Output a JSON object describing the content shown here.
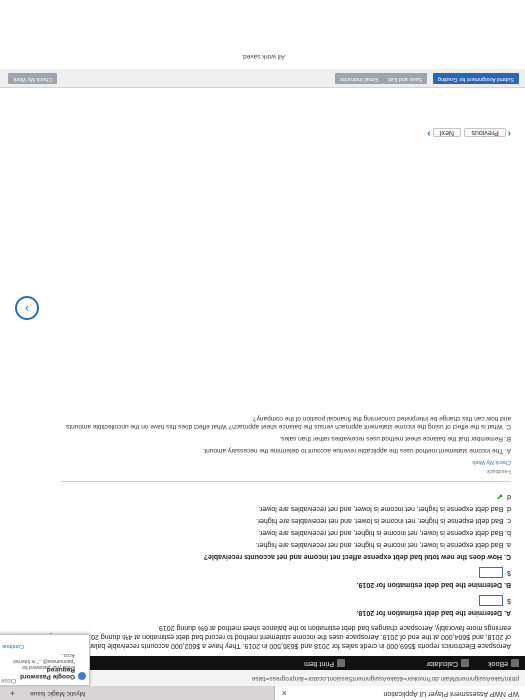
{
  "browser": {
    "tab1_title": "WP NWP Assessment Player UI Application",
    "tab2_title": "Mystic Magic Issue",
    "mail_tab": "Mystic Magic Issue",
    "url": "ptrim/takeAssignment/Main.do?invoker=&takeAssignmentSessionLocator=&inprogress=false"
  },
  "notification": {
    "title": "Google Password Required",
    "body": "Enter your password for \"pannumara@...\" in Internet Acco...",
    "close_label": "Close",
    "continue_label": "Continue"
  },
  "app_bar": {
    "ebook": "eBook",
    "calculator": "Calculator",
    "print": "Print Item"
  },
  "question": {
    "intro": "Aerospace Electronics reports $569,000 in credit sales for 2018 and $636,500 in 2019. They have a $602,000 accounts receivable balance at the end of 2018, and $604,000 at the end of 2019. Aerospace uses the income statement method to record bad debt estimation at 4% during 2018. To manage earnings more favorably, Aerospace changes bad debt estimation to the balance sheet method at 6% during 2019.",
    "part_a": "A. Determine the bad debt estimation for 2018.",
    "part_b": "B. Determine the bad debt estimation for 2019.",
    "part_c": "C. How does the new total bad debt expense affect net income and net accounts receivable?",
    "dollar": "$",
    "options": [
      "a.  Bad debt expense is lower, net income is higher, and net receivables are higher.",
      "b.  Bad debt expense is lower, net income is higher, and net receivables are lower.",
      "c.  Bad debt expense is higher, net income is lower, and net receivables are higher.",
      "d.  Bad debt expense is higher, net income is lower, and net receivables are lower."
    ],
    "selected": "d",
    "check_mark": "✔"
  },
  "feedback": {
    "title": "Feedback",
    "link": "Check My Work",
    "lines": [
      "A. The income statement method uses the applicable revenue account to determine the necessary amount.",
      "B. Remember that the balance sheet method uses receivables rather than sales.",
      "C. What is the effect of using the income statement approach versus the balance sheet approach? What effect does this have on the uncollectible amounts and how can this change be interpreted concerning the financial position of the company?"
    ]
  },
  "navigation": {
    "previous": "Previous",
    "next": "Next"
  },
  "footer": {
    "check_my_work": "Check My Work",
    "email_instructor": "Email Instructor",
    "save_and_exit": "Save and Exit",
    "submit": "Submit Assignment for Grading",
    "status": "All work saved."
  }
}
